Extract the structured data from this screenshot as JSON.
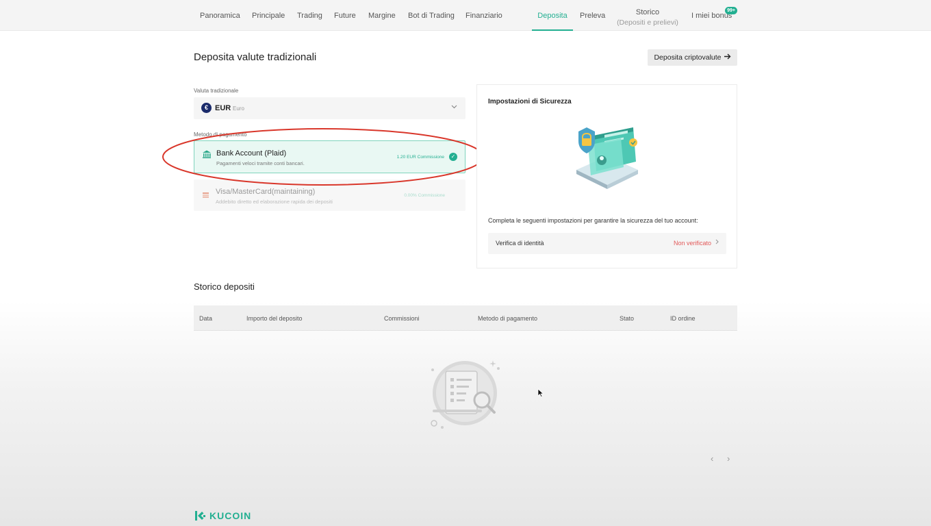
{
  "nav": {
    "items": [
      {
        "label": "Panoramica"
      },
      {
        "label": "Principale"
      },
      {
        "label": "Trading"
      },
      {
        "label": "Future"
      },
      {
        "label": "Margine"
      },
      {
        "label": "Bot di Trading"
      },
      {
        "label": "Finanziario"
      }
    ],
    "deposit": "Deposita",
    "withdraw": "Preleva",
    "history": "Storico",
    "history_sub": "(Depositi e prelievi)",
    "bonus": "I miei bonus",
    "bonus_badge": "99+",
    "active_color": "#23af91"
  },
  "page": {
    "title": "Deposita valute tradizionali",
    "crypto_button": "Deposita criptovalute",
    "crypto_button_icon": "arrow-right-icon"
  },
  "currency": {
    "label": "Valuta tradizionale",
    "code": "EUR",
    "name": "Euro",
    "icon": "euro-icon"
  },
  "payment": {
    "label": "Metodo di pagamento",
    "options": [
      {
        "title": "Bank Account (Plaid)",
        "desc": "Pagamenti veloci tramite conti bancari.",
        "fee": "1.20 EUR Commissione",
        "selected": true,
        "icon": "bank-icon"
      },
      {
        "title": "Visa/MasterCard(maintaining)",
        "desc": "Addebito diretto ed elaborazione rapida dei depositi",
        "fee": "0.00% Commissione",
        "selected": false,
        "icon": "card-icon"
      }
    ],
    "annotation_color": "#d9362a"
  },
  "security": {
    "title": "Impostazioni di Sicurezza",
    "text": "Completa le seguenti impostazioni per garantire la sicurezza del tuo account:",
    "verify_label": "Verifica di identità",
    "verify_status": "Non verificato",
    "verify_status_color": "#e25858"
  },
  "history": {
    "title": "Storico depositi",
    "columns": [
      "Data",
      "Importo del deposito",
      "Commissioni",
      "Metodo di pagamento",
      "Stato",
      "ID ordine"
    ]
  },
  "pager": {
    "prev": "‹",
    "next": "›"
  },
  "brand": {
    "name": "KUCOIN",
    "color": "#23af91"
  }
}
